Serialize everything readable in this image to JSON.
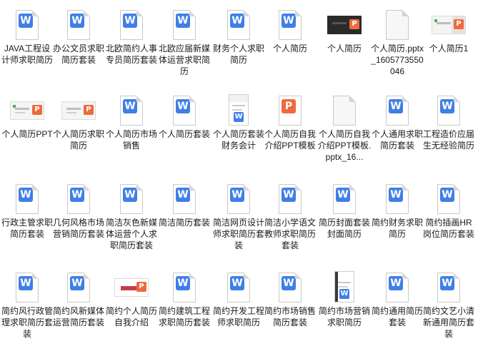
{
  "files": [
    {
      "name": "JAVA工程设计师求职简历",
      "icon": "word-doc-icon"
    },
    {
      "name": "办公文员求职简历套装",
      "icon": "word-doc-icon"
    },
    {
      "name": "北欧简约人事专员简历套装",
      "icon": "word-doc-icon"
    },
    {
      "name": "北欧应届新媒体运营求职简历",
      "icon": "word-doc-icon"
    },
    {
      "name": "财务个人求职简历",
      "icon": "word-doc-icon"
    },
    {
      "name": "个人简历",
      "icon": "word-doc-icon"
    },
    {
      "name": "个人简历",
      "icon": "ppt-thumbnail-dark-icon"
    },
    {
      "name": "个人简历.pptx_1605773550046",
      "icon": "blank-file-icon"
    },
    {
      "name": "个人简历1",
      "icon": "ppt-thumbnail-photo-icon"
    },
    {
      "name": "个人简历PPT",
      "icon": "ppt-thumbnail-green-icon"
    },
    {
      "name": "个人简历求职简历",
      "icon": "ppt-thumbnail-light-icon"
    },
    {
      "name": "个人简历市场销售",
      "icon": "word-doc-icon"
    },
    {
      "name": "个人简历套装",
      "icon": "word-doc-icon"
    },
    {
      "name": "个人简历套装财务会计",
      "icon": "word-thumbnail-green-icon"
    },
    {
      "name": "个人简历自我介绍PPT模板",
      "icon": "ppt-doc-icon"
    },
    {
      "name": "个人简历自我介绍PPT模板.pptx_16...",
      "icon": "blank-file-icon"
    },
    {
      "name": "个人通用求职简历套装",
      "icon": "word-doc-icon"
    },
    {
      "name": "工程造价应届生无经验简历",
      "icon": "word-doc-icon"
    },
    {
      "name": "行政主管求职简历套装",
      "icon": "word-doc-icon"
    },
    {
      "name": "几何风格市场营销简历套装",
      "icon": "word-doc-icon"
    },
    {
      "name": "简洁灰色新媒体运营个人求职简历套装",
      "icon": "word-doc-icon"
    },
    {
      "name": "简洁简历套装",
      "icon": "word-doc-icon"
    },
    {
      "name": "简洁网页设计师求职简历套装",
      "icon": "word-doc-icon"
    },
    {
      "name": "简洁小学语文教师求职简历套装",
      "icon": "word-doc-icon"
    },
    {
      "name": "简历封面套装封面简历",
      "icon": "word-doc-icon"
    },
    {
      "name": "简约财务求职简历",
      "icon": "word-doc-icon"
    },
    {
      "name": "简约插画HR岗位简历套装",
      "icon": "word-doc-icon"
    },
    {
      "name": "简约风行政管理求职简历套装",
      "icon": "word-doc-icon"
    },
    {
      "name": "简约风新媒体运营简历套装",
      "icon": "word-doc-icon"
    },
    {
      "name": "简约个人简历自我介绍",
      "icon": "ppt-thumbnail-pink-icon"
    },
    {
      "name": "简约建筑工程求职简历套装",
      "icon": "word-doc-icon"
    },
    {
      "name": "简约开发工程师求职简历",
      "icon": "word-doc-icon"
    },
    {
      "name": "简约市场销售简历套装",
      "icon": "word-doc-icon"
    },
    {
      "name": "简约市场营销求职简历",
      "icon": "word-thumbnail-dark-icon"
    },
    {
      "name": "简约通用简历套装",
      "icon": "word-doc-icon"
    },
    {
      "name": "简约文艺小清新通用简历套装",
      "icon": "word-doc-icon"
    }
  ],
  "colors": {
    "word_blue": "#3f7fe6",
    "ppt_orange": "#ee6a3d",
    "text": "#1a1a1a"
  }
}
